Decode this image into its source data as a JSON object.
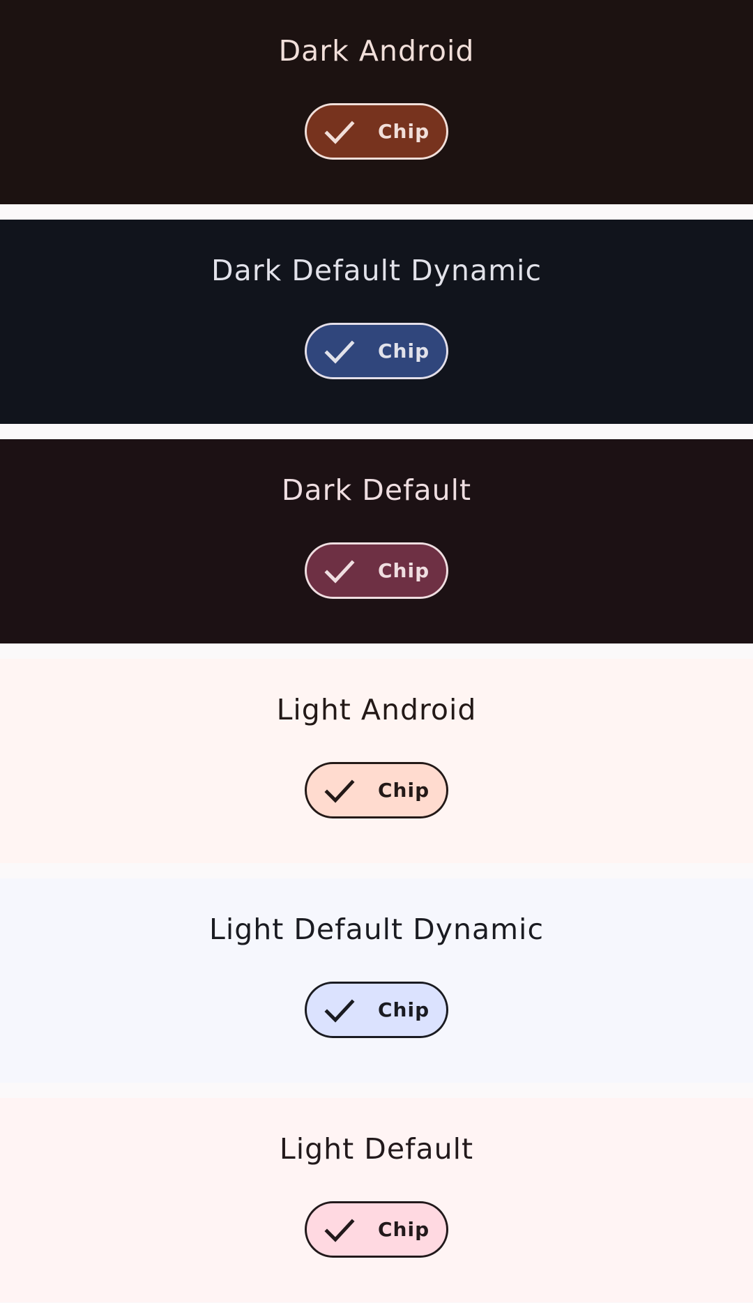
{
  "page": {
    "background": "#fbf9fa"
  },
  "sections": [
    {
      "title": "Dark Android",
      "chip": {
        "label": "Chip",
        "selected": true,
        "icon": "check-icon"
      },
      "colors": {
        "background": "#1c1211",
        "title": "#f1dfda",
        "chip_fill": "#77331e",
        "chip_border": "#f1dfda",
        "chip_text": "#f1dfda"
      }
    },
    {
      "title": "Dark Default Dynamic",
      "chip": {
        "label": "Chip",
        "selected": true,
        "icon": "check-icon"
      },
      "colors": {
        "background": "#11141c",
        "title": "#e2e2ea",
        "chip_fill": "#30467c",
        "chip_border": "#e4dfe9",
        "chip_text": "#e2e2ea"
      }
    },
    {
      "title": "Dark Default",
      "chip": {
        "label": "Chip",
        "selected": true,
        "icon": "check-icon"
      },
      "colors": {
        "background": "#1c1114",
        "title": "#efdee1",
        "chip_fill": "#6e3044",
        "chip_border": "#efdee1",
        "chip_text": "#efdee1"
      }
    },
    {
      "title": "Light Android",
      "chip": {
        "label": "Chip",
        "selected": true,
        "icon": "check-icon"
      },
      "colors": {
        "background": "#fff5f3",
        "title": "#231917",
        "chip_fill": "#ffdbcf",
        "chip_border": "#231917",
        "chip_text": "#231917"
      }
    },
    {
      "title": "Light Default Dynamic",
      "chip": {
        "label": "Chip",
        "selected": true,
        "icon": "check-icon"
      },
      "colors": {
        "background": "#f6f7fd",
        "title": "#1a1b21",
        "chip_fill": "#dbe2fe",
        "chip_border": "#1a1b21",
        "chip_text": "#1a1b21"
      }
    },
    {
      "title": "Light Default",
      "chip": {
        "label": "Chip",
        "selected": true,
        "icon": "check-icon"
      },
      "colors": {
        "background": "#fff4f4",
        "title": "#22191b",
        "chip_fill": "#ffd9e1",
        "chip_border": "#22191b",
        "chip_text": "#22191b"
      }
    }
  ]
}
